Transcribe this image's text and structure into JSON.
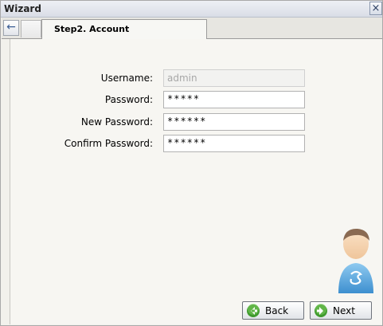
{
  "window": {
    "title": "Wizard",
    "close_glyph": "×"
  },
  "tabs": {
    "back_glyph": "←",
    "active_label": "Step2. Account"
  },
  "form": {
    "username_label": "Username:",
    "username_value": "admin",
    "password_label": "Password:",
    "password_value": "*****",
    "new_password_label": "New Password:",
    "new_password_value": "******",
    "confirm_password_label": "Confirm Password:",
    "confirm_password_value": "******"
  },
  "buttons": {
    "back_label": "Back",
    "next_label": "Next"
  },
  "icons": {
    "back_button_icon": "green-arrow-left-icon",
    "next_button_icon": "green-arrow-right-icon",
    "user_avatar": "user-avatar-icon"
  },
  "colors": {
    "arrow_green": "#3f9a2e",
    "avatar_blue": "#5aa7dd"
  }
}
